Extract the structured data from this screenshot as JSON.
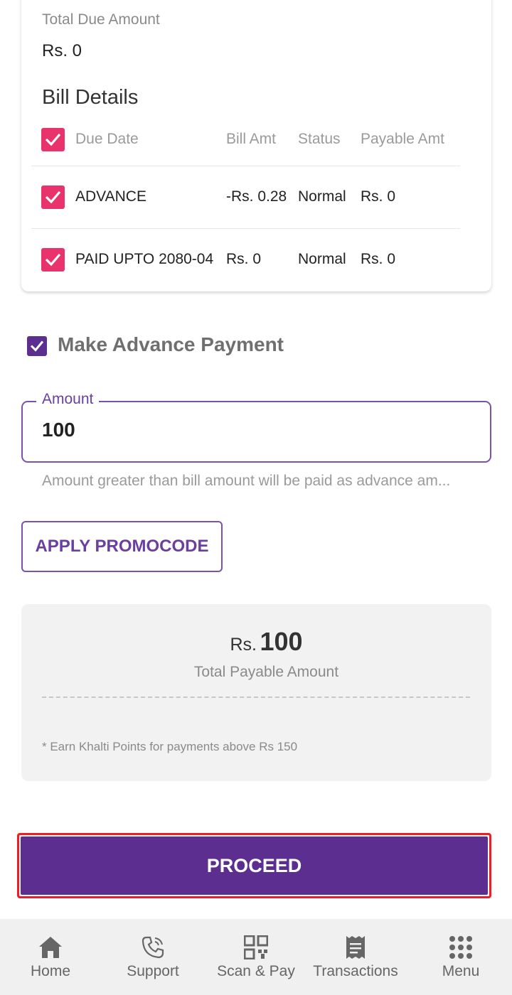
{
  "summary_top": {
    "due_label": "Total Due Amount",
    "due_value": "Rs. 0"
  },
  "bill_details": {
    "title": "Bill Details",
    "headers": [
      "Due Date",
      "Bill Amt",
      "Status",
      "Payable Amt"
    ],
    "rows": [
      {
        "due_date": "ADVANCE",
        "bill_amt": "-Rs. 0.28",
        "status": "Normal",
        "payable_amt": "Rs. 0",
        "checked": true
      },
      {
        "due_date": "PAID UPTO 2080-04",
        "bill_amt": "Rs. 0",
        "status": "Normal",
        "payable_amt": "Rs. 0",
        "checked": true
      }
    ],
    "header_checked": true
  },
  "advance": {
    "label": "Make Advance Payment",
    "checked": true
  },
  "amount": {
    "legend": "Amount",
    "value": "100",
    "helper": "Amount greater than bill amount will be paid as advance am..."
  },
  "promo_label": "APPLY PROMOCODE",
  "payable": {
    "currency": "Rs.",
    "value": "100",
    "label": "Total Payable Amount",
    "note": "* Earn Khalti Points for payments above Rs 150"
  },
  "proceed_label": "PROCEED",
  "nav": {
    "items": [
      {
        "label": "Home",
        "icon": "home-icon"
      },
      {
        "label": "Support",
        "icon": "phone-icon"
      },
      {
        "label": "Scan & Pay",
        "icon": "qr-code-icon"
      },
      {
        "label": "Transactions",
        "icon": "receipt-icon"
      },
      {
        "label": "Menu",
        "icon": "grid-menu-icon"
      }
    ]
  },
  "colors": {
    "primary": "#5b2e8f",
    "accent_checkbox": "#e8336d",
    "highlight_outline": "#ee1c25"
  }
}
